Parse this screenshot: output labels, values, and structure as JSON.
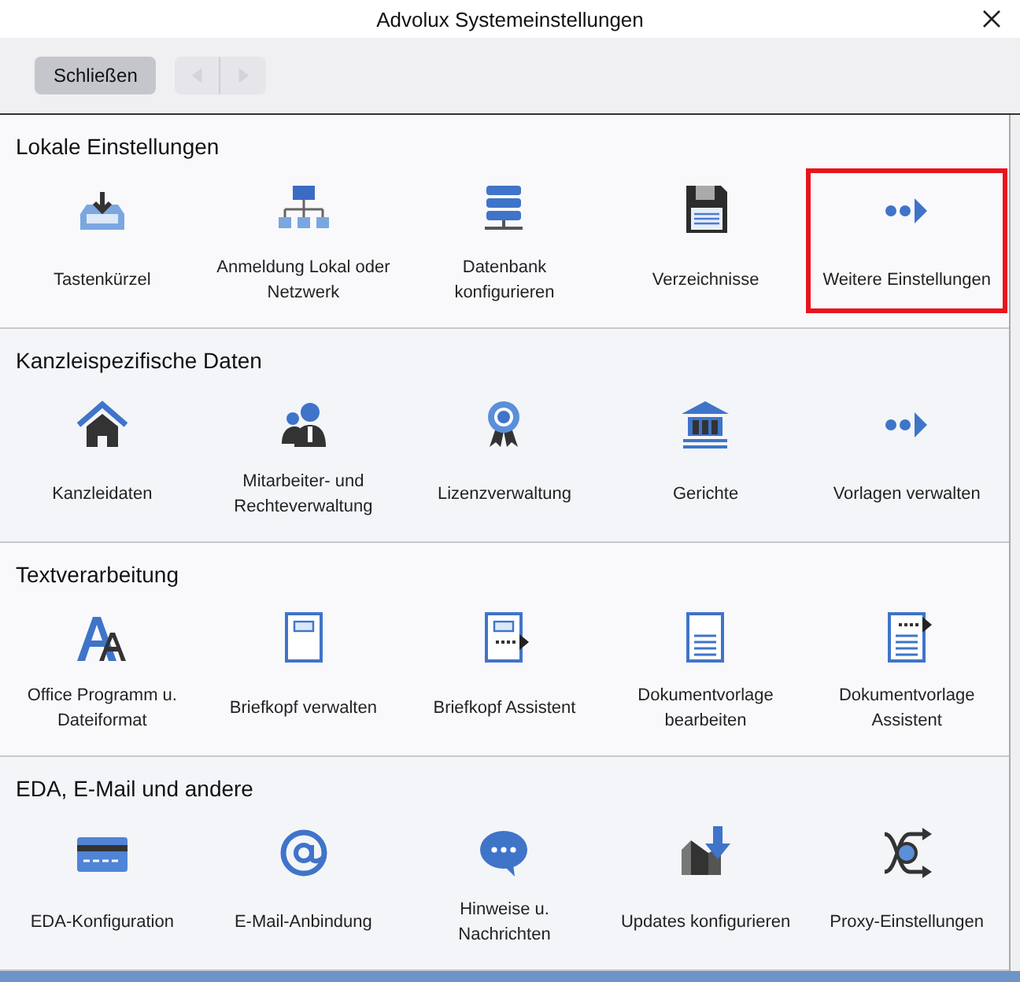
{
  "window": {
    "title": "Advolux Systemeinstellungen"
  },
  "toolbar": {
    "close_label": "Schließen",
    "back_disabled": true,
    "forward_disabled": true
  },
  "sections": [
    {
      "title": "Lokale Einstellungen",
      "items": [
        {
          "kind": "tray-download",
          "label": "Tastenkürzel",
          "highlighted": false
        },
        {
          "kind": "network",
          "label": "Anmeldung Lokal oder Netzwerk",
          "highlighted": false
        },
        {
          "kind": "server",
          "label": "Datenbank konfigurieren",
          "highlighted": false
        },
        {
          "kind": "floppy",
          "label": "Verzeichnisse",
          "highlighted": false
        },
        {
          "kind": "more",
          "label": "Weitere Einstellungen",
          "highlighted": true
        }
      ]
    },
    {
      "title": "Kanzleispezifische Daten",
      "items": [
        {
          "kind": "house",
          "label": "Kanzleidaten",
          "highlighted": false
        },
        {
          "kind": "people",
          "label": "Mitarbeiter- und Rechteverwaltung",
          "highlighted": false
        },
        {
          "kind": "ribbon",
          "label": "Lizenzverwaltung",
          "highlighted": false
        },
        {
          "kind": "bank",
          "label": "Gerichte",
          "highlighted": false
        },
        {
          "kind": "more",
          "label": "Vorlagen verwalten",
          "highlighted": false
        }
      ]
    },
    {
      "title": "Textverarbeitung",
      "items": [
        {
          "kind": "font",
          "label": "Office Programm u. Dateiformat",
          "highlighted": false
        },
        {
          "kind": "letterhead",
          "label": "Briefkopf verwalten",
          "highlighted": false
        },
        {
          "kind": "letterhead-arrow",
          "label": "Briefkopf Assistent",
          "highlighted": false
        },
        {
          "kind": "document",
          "label": "Dokumentvorlage bearbeiten",
          "highlighted": false
        },
        {
          "kind": "document-arrow",
          "label": "Dokumentvorlage Assistent",
          "highlighted": false
        }
      ]
    },
    {
      "title": "EDA, E-Mail und andere",
      "items": [
        {
          "kind": "card",
          "label": "EDA-Konfiguration",
          "highlighted": false
        },
        {
          "kind": "at",
          "label": "E-Mail-Anbindung",
          "highlighted": false
        },
        {
          "kind": "chat",
          "label": "Hinweise u. Nachrichten",
          "highlighted": false
        },
        {
          "kind": "update",
          "label": "Updates konfigurieren",
          "highlighted": false
        },
        {
          "kind": "proxy",
          "label": "Proxy-Einstellungen",
          "highlighted": false
        }
      ]
    }
  ]
}
